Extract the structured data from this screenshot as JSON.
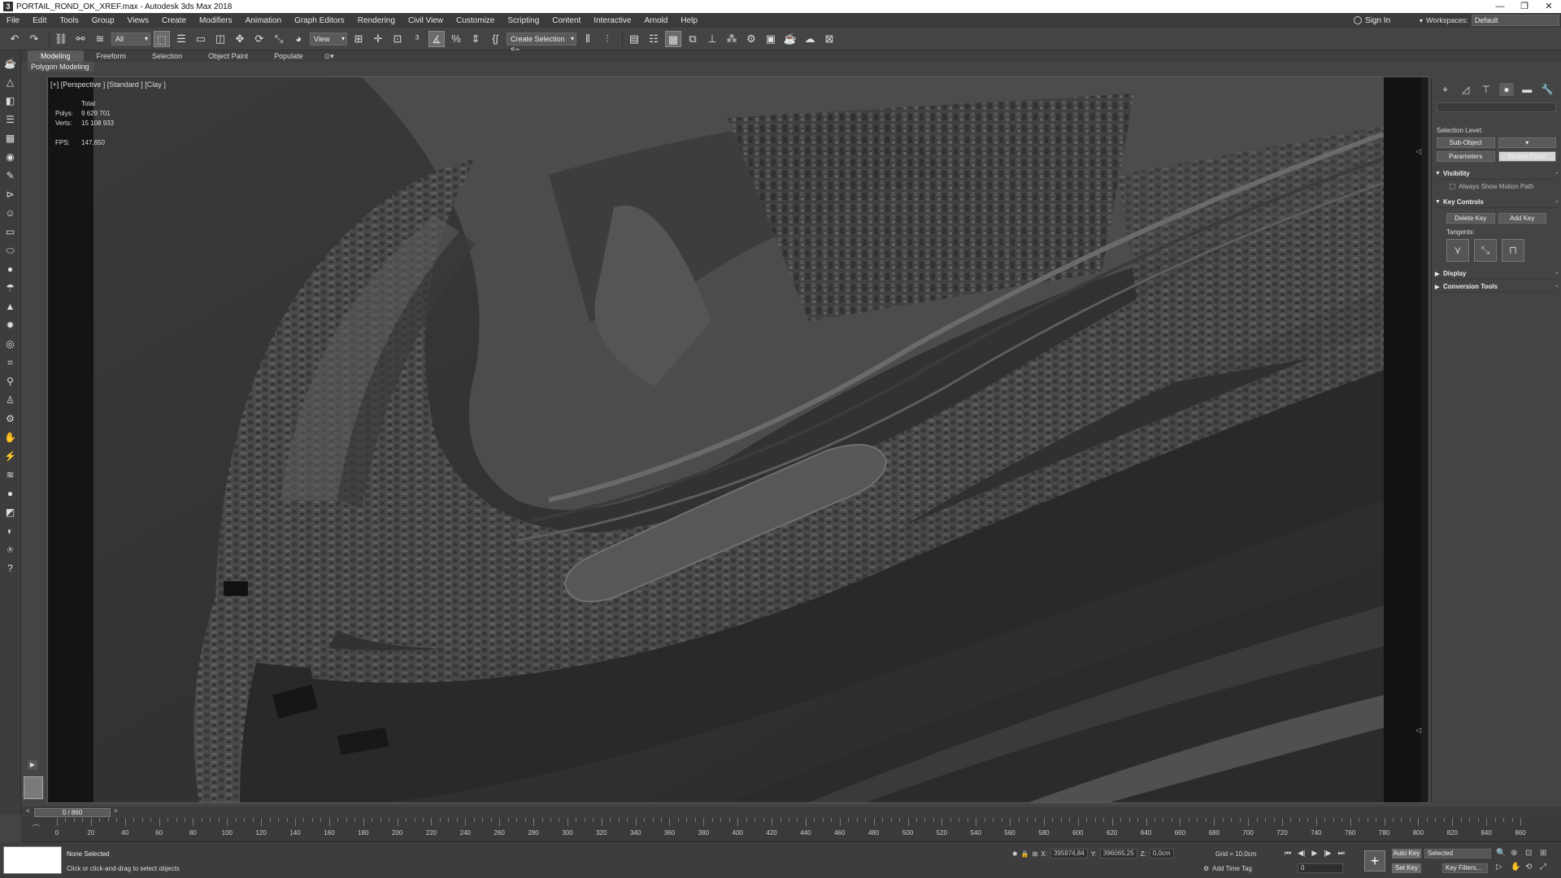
{
  "window": {
    "app_icon": "3",
    "title": "PORTAIL_ROND_OK_XREF.max - Autodesk 3ds Max 2018",
    "controls": [
      "minimize-icon",
      "maximize-icon",
      "close-icon"
    ]
  },
  "menu": {
    "items": [
      "File",
      "Edit",
      "Tools",
      "Group",
      "Views",
      "Create",
      "Modifiers",
      "Animation",
      "Graph Editors",
      "Rendering",
      "Civil View",
      "Customize",
      "Scripting",
      "Content",
      "Interactive",
      "Arnold",
      "Help"
    ],
    "sign_in": "Sign In",
    "workspaces_label": "Workspaces:",
    "workspaces_value": "Default"
  },
  "toolbar": {
    "filter_value": "All",
    "reference_coord": "View",
    "selection_set": "Create Selection Se"
  },
  "ribbon": {
    "tabs": [
      "Modeling",
      "Freeform",
      "Selection",
      "Object Paint",
      "Populate"
    ],
    "active_tab": "Modeling",
    "sub_label": "Polygon Modeling"
  },
  "viewport": {
    "label": "[+] [Perspective ] [Standard ] [Clay ]",
    "stats_header": "Total",
    "polys_label": "Polys:",
    "polys_value": "9 629 701",
    "verts_label": "Verts:",
    "verts_value": "15 108 933",
    "fps_label": "FPS:",
    "fps_value": "147,650"
  },
  "command_panel": {
    "selection_level": "Selection Level:",
    "sub_object": "Sub-Object",
    "parameters": "Parameters",
    "motion_paths": "Motion Paths",
    "visibility": "Visibility",
    "always_show": "Always Show Motion Path",
    "key_controls": "Key Controls",
    "delete_key": "Delete Key",
    "add_key": "Add Key",
    "tangents": "Tangents:",
    "display": "Display",
    "conversion_tools": "Conversion Tools"
  },
  "timeline": {
    "frame_range": "0 / 860",
    "ticks": [
      0,
      20,
      40,
      60,
      80,
      100,
      120,
      140,
      160,
      180,
      200,
      220,
      240,
      260,
      280,
      300,
      320,
      340,
      360,
      380,
      400,
      420,
      440,
      460,
      480,
      500,
      520,
      540,
      560,
      580,
      600,
      620,
      640,
      660,
      680,
      700,
      720,
      740,
      760,
      780,
      800,
      820,
      840,
      860
    ]
  },
  "status": {
    "selection": "None Selected",
    "prompt": "Click or click-and-drag to select objects",
    "x_label": "X:",
    "x_value": "395974,84",
    "y_label": "Y:",
    "y_value": "396065,25",
    "z_label": "Z:",
    "z_value": "0,0cm",
    "grid": "Grid = 10,0cm",
    "add_time_tag": "Add Time Tag",
    "frame": "0",
    "auto_key": "Auto Key",
    "set_key": "Set Key",
    "selected": "Selected",
    "key_filters": "Key Filters..."
  }
}
